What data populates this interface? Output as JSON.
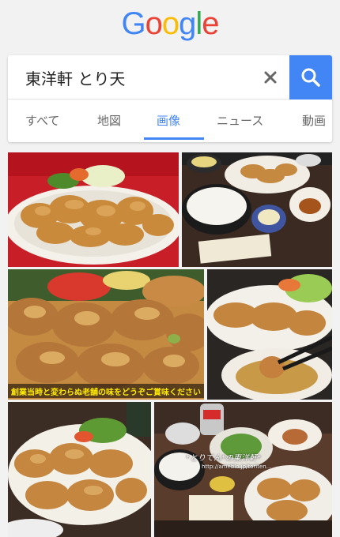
{
  "logo": {
    "letters": [
      "G",
      "o",
      "o",
      "g",
      "l",
      "e"
    ],
    "colors": [
      "#4285f4",
      "#ea4335",
      "#fbbc05",
      "#4285f4",
      "#34a853",
      "#ea4335"
    ]
  },
  "search": {
    "query": "東洋軒 とり天",
    "clear_icon": "close-icon",
    "search_icon": "search-icon"
  },
  "tabs": [
    {
      "label": "すべて",
      "active": false
    },
    {
      "label": "地図",
      "active": false
    },
    {
      "label": "画像",
      "active": true
    },
    {
      "label": "ニュース",
      "active": false
    },
    {
      "label": "動画",
      "active": false
    }
  ],
  "results": {
    "image3_caption": "創業当時と変わらぬ老舗の味をどうぞご賞味ください",
    "image6_watermark": "*とりてん*の東洋軒*",
    "image6_url": "http://ameblo.jp/toriten..."
  },
  "colors": {
    "accent": "#4285f4",
    "background": "#f2f2f2"
  }
}
